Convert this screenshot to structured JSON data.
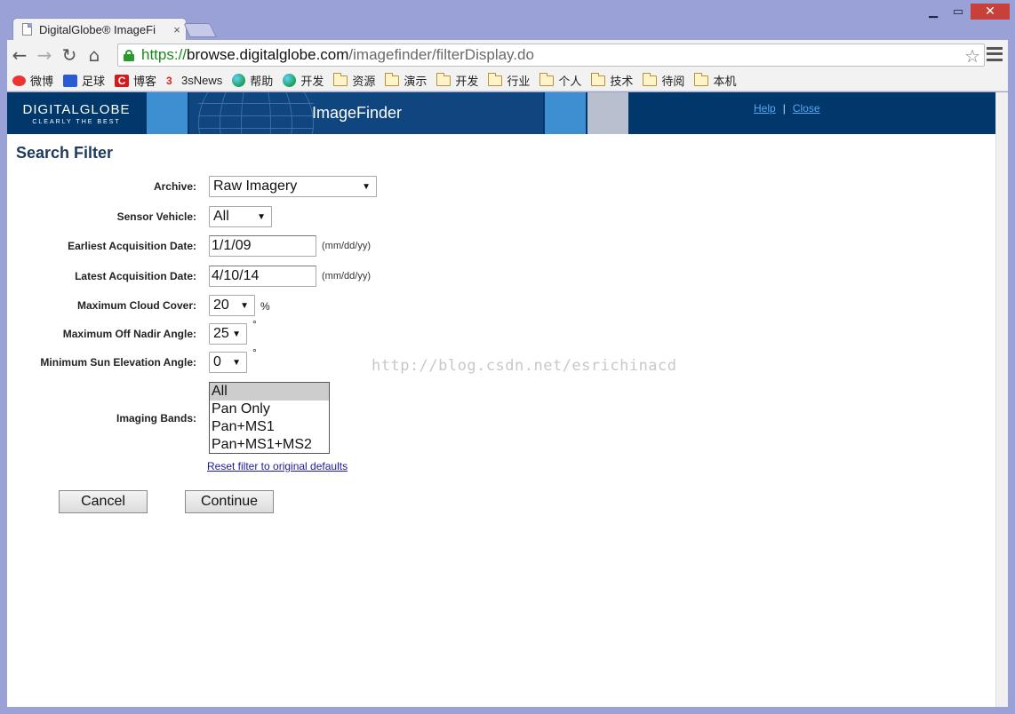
{
  "browser": {
    "tab_title": "DigitalGlobe® ImageFi",
    "tab_close": "×",
    "url": {
      "scheme": "https://",
      "host": "browse.digitalglobe.com",
      "path": "/imagefinder/filterDisplay.do"
    },
    "bookmarks": [
      {
        "label": "微博",
        "icon": "weibo-icon"
      },
      {
        "label": "足球",
        "icon": "paw-icon"
      },
      {
        "label": "博客",
        "icon": "c-icon"
      },
      {
        "label": "3sNews",
        "icon": "3s-icon"
      },
      {
        "label": "帮助",
        "icon": "globe-icon"
      },
      {
        "label": "开发",
        "icon": "globe-icon"
      },
      {
        "label": "资源",
        "icon": "folder-icon"
      },
      {
        "label": "演示",
        "icon": "folder-icon"
      },
      {
        "label": "开发",
        "icon": "folder-icon"
      },
      {
        "label": "行业",
        "icon": "folder-icon"
      },
      {
        "label": "个人",
        "icon": "folder-icon"
      },
      {
        "label": "技术",
        "icon": "folder-icon"
      },
      {
        "label": "待阅",
        "icon": "folder-icon"
      },
      {
        "label": "本机",
        "icon": "folder-icon"
      }
    ]
  },
  "banner": {
    "logo_main": "DIGITALGLOBE",
    "logo_tag": "CLEARLY THE BEST",
    "title": "ImageFinder",
    "help_link": "Help",
    "separator": "|",
    "close_link": "Close"
  },
  "form": {
    "title": "Search Filter",
    "archive_label": "Archive:",
    "archive_value": "Raw Imagery",
    "sensor_label": "Sensor Vehicle:",
    "sensor_value": "All",
    "earliest_label": "Earliest Acquisition Date:",
    "earliest_value": "1/1/09",
    "latest_label": "Latest Acquisition Date:",
    "latest_value": "4/10/14",
    "date_hint": "(mm/dd/yy)",
    "cloud_label": "Maximum Cloud Cover:",
    "cloud_value": "20",
    "cloud_unit": "%",
    "nadir_label": "Maximum Off Nadir Angle:",
    "nadir_value": "25",
    "degree_unit": "°",
    "sun_label": "Minimum Sun Elevation Angle:",
    "sun_value": "0",
    "bands_label": "Imaging Bands:",
    "bands_options": [
      "All",
      "Pan Only",
      "Pan+MS1",
      "Pan+MS1+MS2"
    ],
    "bands_selected": "All",
    "reset_link": "Reset filter to original defaults",
    "cancel_label": "Cancel",
    "continue_label": "Continue"
  },
  "watermark": "http://blog.csdn.net/esrichinacd",
  "colors": {
    "banner_navy": "#00386b",
    "banner_lightblue": "#3d8fd1",
    "banner_grey": "#b8c0cf",
    "title_color": "#1f3a5a",
    "link_color": "#1b1b9a"
  }
}
